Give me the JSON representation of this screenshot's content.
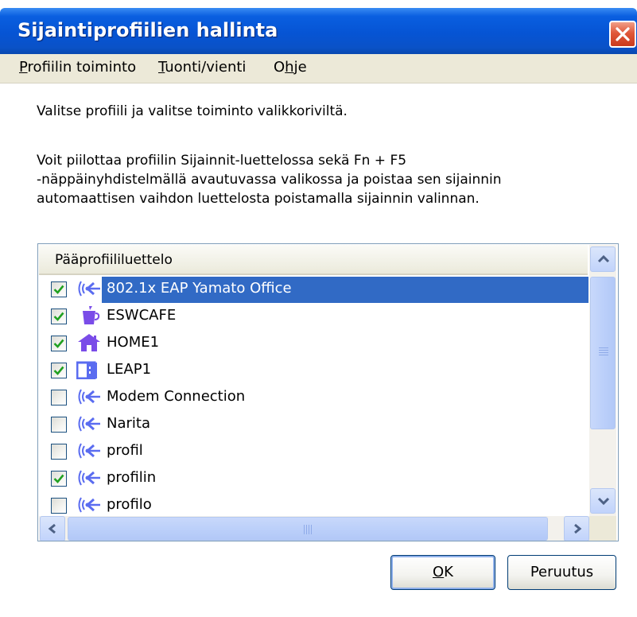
{
  "window": {
    "title": "Sijaintiprofiilien hallinta"
  },
  "menu": {
    "items": [
      {
        "label": "Profiilin toiminto",
        "mnemonic": "P",
        "rest": "rofiilin toiminto"
      },
      {
        "label": "Tuonti/vienti",
        "mnemonic": "T",
        "rest": "uonti/vienti"
      },
      {
        "label": "Ohje",
        "pre": "O",
        "mnemonic": "h",
        "rest": "je"
      }
    ]
  },
  "intro_text": "Valitse profiili ja valitse toiminto valikkoriviltä.",
  "description": [
    "Voit piilottaa profiilin Sijainnit-luettelossa sekä Fn + F5",
    "-näppäinyhdistelmällä avautuvassa valikossa ja poistaa sen sijainnin",
    "automaattisen vaihdon luettelosta poistamalla sijainnin valinnan."
  ],
  "profile_list": {
    "header": "Pääprofiililuettelo",
    "items": [
      {
        "label": "802.1x EAP Yamato Office",
        "checked": true,
        "icon": "wireless-network-icon",
        "selected": true
      },
      {
        "label": "ESWCAFE",
        "checked": true,
        "icon": "coffee-cup-icon",
        "selected": false
      },
      {
        "label": "HOME1",
        "checked": true,
        "icon": "home-icon",
        "selected": false
      },
      {
        "label": "LEAP1",
        "checked": true,
        "icon": "office-building-icon",
        "selected": false
      },
      {
        "label": "Modem Connection",
        "checked": false,
        "icon": "wireless-network-icon",
        "selected": false
      },
      {
        "label": "Narita",
        "checked": false,
        "icon": "wireless-network-icon",
        "selected": false
      },
      {
        "label": "profil",
        "checked": false,
        "icon": "wireless-network-icon",
        "selected": false
      },
      {
        "label": "profilin",
        "checked": true,
        "icon": "wireless-network-icon",
        "selected": false
      },
      {
        "label": "profilo",
        "checked": false,
        "icon": "wireless-network-icon",
        "selected": false
      }
    ]
  },
  "buttons": {
    "ok": {
      "label": "OK",
      "mnemonic": "O",
      "rest": "K"
    },
    "cancel": {
      "label": "Peruutus"
    }
  },
  "colors": {
    "titlebar": "#0654d4",
    "selection": "#316ac5",
    "icon_blue": "#5a6cf0",
    "icon_purple": "#7a4ce8",
    "checkmark": "#21a121"
  }
}
